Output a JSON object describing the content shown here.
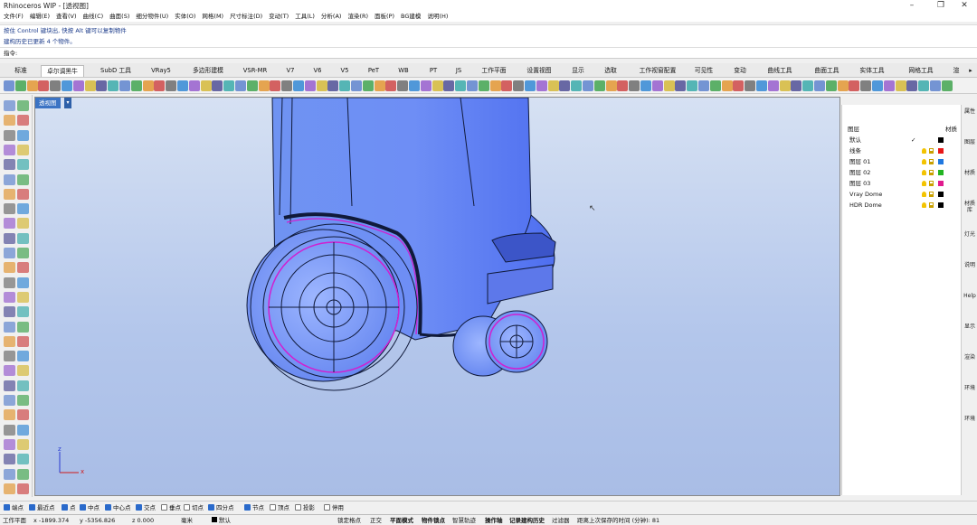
{
  "window": {
    "title": "Rhinoceros WIP - [透视图]"
  },
  "menu": [
    "文件(F)",
    "编辑(E)",
    "查看(V)",
    "曲线(C)",
    "曲面(S)",
    "细分物件(U)",
    "实体(O)",
    "网格(M)",
    "尺寸标注(D)",
    "变动(T)",
    "工具(L)",
    "分析(A)",
    "渲染(R)",
    "面板(P)",
    "BG建模",
    "说明(H)"
  ],
  "command_history": [
    "按住 Control 键块出, 快按 Alt 键可以复制物件",
    "建构历史已更新 4 个物件。"
  ],
  "command_prompt": "指令:",
  "tabs": [
    "标准",
    "卓尔调黑牛",
    "SubD 工具",
    "VRay5",
    "多边形建模",
    "VSR-MR",
    "V7",
    "V6",
    "V5",
    "PeT",
    "WB",
    "PT",
    "JS",
    "工作平面",
    "设置视图",
    "显示",
    "选取",
    "工作视窗配置",
    "可见性",
    "变动",
    "曲线工具",
    "曲面工具",
    "实体工具",
    "网格工具",
    "渲"
  ],
  "active_tab_index": 1,
  "viewport": {
    "label": "透视图",
    "axis_x": "x",
    "axis_y": "y",
    "axis_z": "z"
  },
  "layers": {
    "header_left": "图层",
    "header_right": "材质",
    "rows": [
      {
        "name": "默认",
        "current": true,
        "color": "#000000"
      },
      {
        "name": "线条",
        "current": false,
        "color": "#e81818"
      },
      {
        "name": "图层 01",
        "current": false,
        "color": "#1f78e0"
      },
      {
        "name": "图层 02",
        "current": false,
        "color": "#22b422"
      },
      {
        "name": "图层 03",
        "current": false,
        "color": "#e01a8e"
      },
      {
        "name": "Vray Dome",
        "current": false,
        "color": "#000000"
      },
      {
        "name": "HDR Dome",
        "current": false,
        "color": "#000000"
      }
    ]
  },
  "right_tabs": [
    "属性",
    "图层",
    "材质",
    "材质库",
    "灯光",
    "说明",
    "Help",
    "显示",
    "渲染",
    "环境",
    "环境"
  ],
  "osnap": [
    {
      "label": "端点",
      "on": true
    },
    {
      "label": "最近点",
      "on": true
    },
    {
      "label": "点",
      "on": true
    },
    {
      "label": "中点",
      "on": true
    },
    {
      "label": "中心点",
      "on": true
    },
    {
      "label": "交点",
      "on": true
    },
    {
      "label": "垂点",
      "on": false
    },
    {
      "label": "切点",
      "on": false
    },
    {
      "label": "四分点",
      "on": true
    },
    {
      "label": "节点",
      "on": true
    },
    {
      "label": "顶点",
      "on": false
    },
    {
      "label": "投影",
      "on": false
    },
    {
      "label": "停用",
      "on": false
    }
  ],
  "status": {
    "plane": "工作平面",
    "x": "x -1899.374",
    "y": "y -5356.826",
    "z": "z 0.000",
    "unit": "毫米",
    "layer": "默认",
    "items": [
      "锁定格点",
      "正交",
      "平面模式",
      "物件锁点",
      "智慧轨迹",
      "操作轴",
      "记录建构历史",
      "过滤器",
      "距离上次保存的时间 (分钟): 81"
    ]
  }
}
